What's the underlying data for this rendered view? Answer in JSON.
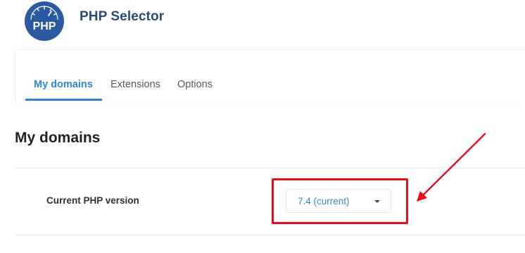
{
  "app": {
    "title": "PHP Selector",
    "logo_text": "PHP",
    "logo_color": "#2c5aa0"
  },
  "tabs": [
    {
      "label": "My domains",
      "active": true
    },
    {
      "label": "Extensions",
      "active": false
    },
    {
      "label": "Options",
      "active": false
    }
  ],
  "section": {
    "title": "My domains"
  },
  "php_version_row": {
    "label": "Current PHP version",
    "selected": "7.4 (current)",
    "dropdown_icon": "caret-down-icon"
  },
  "annotation": {
    "highlight_color": "#e40f18",
    "arrow_icon": "red-arrow-icon"
  },
  "colors": {
    "accent": "#2f86d8",
    "title": "#2a4a79"
  }
}
